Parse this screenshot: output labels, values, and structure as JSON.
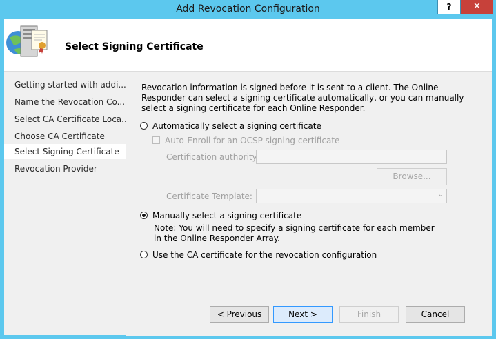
{
  "window": {
    "title": "Add Revocation Configuration",
    "help_label": "?",
    "close_label": "✕"
  },
  "header": {
    "title": "Select Signing Certificate",
    "icon": "server-certificate-icon"
  },
  "nav": {
    "items": [
      {
        "label": "Getting started with addi...",
        "selected": false
      },
      {
        "label": "Name the Revocation Co...",
        "selected": false
      },
      {
        "label": "Select CA Certificate Loca...",
        "selected": false
      },
      {
        "label": "Choose CA Certificate",
        "selected": false
      },
      {
        "label": "Select Signing Certificate",
        "selected": true
      },
      {
        "label": "Revocation Provider",
        "selected": false
      }
    ]
  },
  "content": {
    "description": "Revocation information is signed before it is sent to a client. The Online Responder can select a signing certificate automatically, or you can manually select a signing certificate for each Online Responder.",
    "option_auto": "Automatically select a signing certificate",
    "auto_enroll": "Auto-Enroll for an OCSP signing certificate",
    "ca_label": "Certification authority:",
    "ca_value": "",
    "browse": "Browse...",
    "template_label": "Certificate Template:",
    "template_value": "",
    "option_manual": "Manually select a signing certificate",
    "manual_note": "Note: You will need to specify a signing certificate for each member in the Online Responder Array.",
    "option_ca": "Use the CA certificate for the revocation configuration",
    "selected_option": "manual"
  },
  "footer": {
    "previous": "< Previous",
    "next": "Next >",
    "finish": "Finish",
    "cancel": "Cancel"
  }
}
